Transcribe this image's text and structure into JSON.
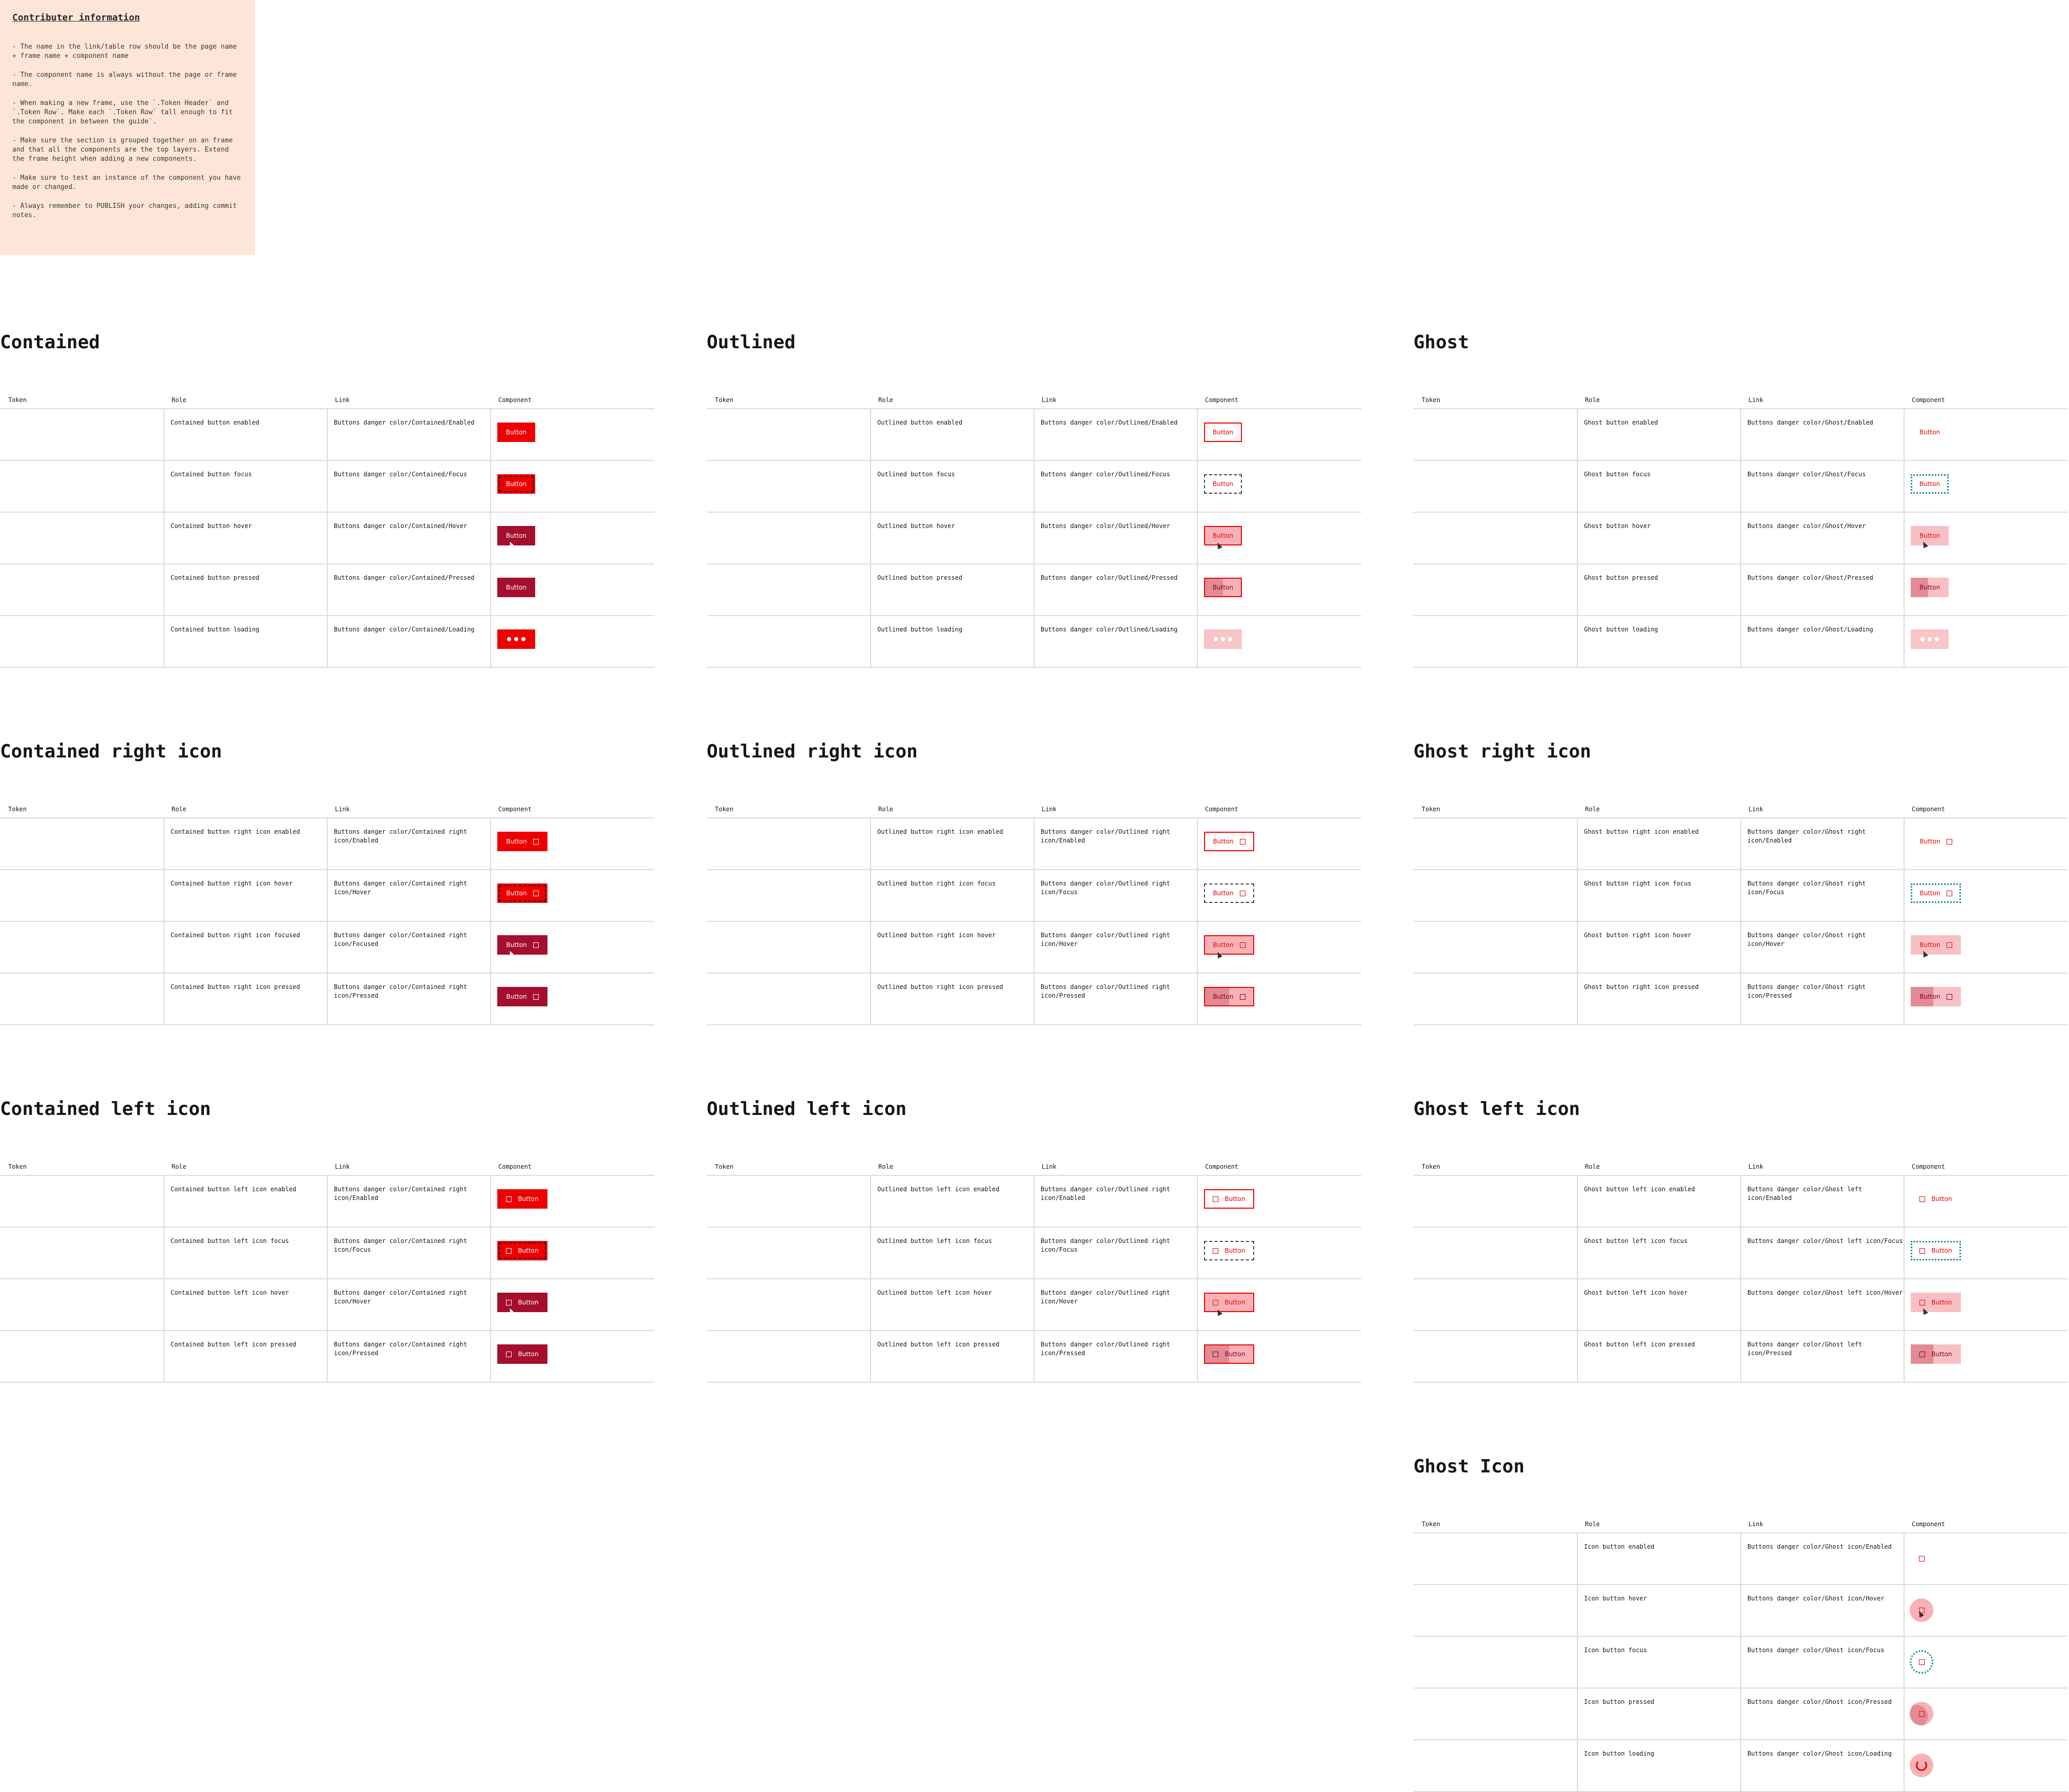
{
  "info": {
    "title": "Contributer information",
    "paragraphs": [
      "- The name in the link/table row should be the page name + frame name + component name",
      "- The component name is always without the page or frame name.",
      "- When making a new frame, use the `.Token Header` and `.Token Row`. Make each `.Token Row` tall enough to fit the component in between the guide`.",
      "- Make sure the section is grouped together on an frame and that all the components are the top layers. Extend the frame height when adding a new components.",
      "- Make sure to test an instance of the component you have made or changed.",
      "- Always remember to PUBLISH your changes, adding commit notes."
    ]
  },
  "headers": [
    "Token",
    "Role",
    "Link",
    "Component"
  ],
  "button_label": "Button",
  "colors": {
    "danger": "#ee0000",
    "danger_hover": "#a50e2d",
    "focus_ring": "#1d8a98",
    "ghost_hover": "#f8b2b7",
    "info_bg": "#fde6d7"
  },
  "sections": [
    {
      "title": "Contained",
      "kind": "contained",
      "icon": "none",
      "rows": [
        {
          "role": "Contained button enabled",
          "link": "Buttons danger color/Contained/Enabled",
          "state": "enabled"
        },
        {
          "role": "Contained button focus",
          "link": "Buttons danger color/Contained/Focus",
          "state": "focus"
        },
        {
          "role": "Contained button hover",
          "link": "Buttons danger color/Contained/Hover",
          "state": "hover"
        },
        {
          "role": "Contained button pressed",
          "link": "Buttons danger color/Contained/Pressed",
          "state": "pressed"
        },
        {
          "role": "Contained button loading",
          "link": "Buttons danger color/Contained/Loading",
          "state": "loading"
        }
      ]
    },
    {
      "title": "Outlined",
      "kind": "outlined",
      "icon": "none",
      "rows": [
        {
          "role": "Outlined button enabled",
          "link": "Buttons danger color/Outlined/Enabled",
          "state": "enabled"
        },
        {
          "role": "Outlined button focus",
          "link": "Buttons danger color/Outlined/Focus",
          "state": "focus"
        },
        {
          "role": "Outlined button hover",
          "link": "Buttons danger color/Outlined/Hover",
          "state": "hover"
        },
        {
          "role": "Outlined button pressed",
          "link": "Buttons danger color/Outlined/Pressed",
          "state": "pressed"
        },
        {
          "role": "Outlined button loading",
          "link": "Buttons danger color/Outlined/Loading",
          "state": "loading"
        }
      ]
    },
    {
      "title": "Ghost",
      "kind": "ghost",
      "icon": "none",
      "rows": [
        {
          "role": "Ghost button enabled",
          "link": "Buttons danger color/Ghost/Enabled",
          "state": "enabled"
        },
        {
          "role": "Ghost button focus",
          "link": "Buttons danger color/Ghost/Focus",
          "state": "focus"
        },
        {
          "role": "Ghost button hover",
          "link": "Buttons danger color/Ghost/Hover",
          "state": "hover"
        },
        {
          "role": "Ghost button pressed",
          "link": "Buttons danger color/Ghost/Pressed",
          "state": "pressed"
        },
        {
          "role": "Ghost button loading",
          "link": "Buttons danger color/Ghost/Loading",
          "state": "loading"
        }
      ]
    },
    {
      "title": "Contained right icon",
      "kind": "contained",
      "icon": "right",
      "rows": [
        {
          "role": "Contained button right icon enabled",
          "link": "Buttons danger color/Contained right icon/Enabled",
          "state": "enabled"
        },
        {
          "role": "Contained button right icon hover",
          "link": "Buttons danger color/Contained right icon/Hover",
          "state": "focus"
        },
        {
          "role": "Contained button right icon focused",
          "link": "Buttons danger color/Contained right icon/Focused",
          "state": "hover"
        },
        {
          "role": "Contained button right icon pressed",
          "link": "Buttons danger color/Contained right icon/Pressed",
          "state": "pressed"
        }
      ]
    },
    {
      "title": "Outlined right icon",
      "kind": "outlined",
      "icon": "right",
      "rows": [
        {
          "role": "Outlined button right icon enabled",
          "link": "Buttons danger color/Outlined right icon/Enabled",
          "state": "enabled"
        },
        {
          "role": "Outlined button right icon focus",
          "link": "Buttons danger color/Outlined right icon/Focus",
          "state": "focus"
        },
        {
          "role": "Outlined button right icon hover",
          "link": "Buttons danger color/Outlined right icon/Hover",
          "state": "hover"
        },
        {
          "role": "Outlined button right icon pressed",
          "link": "Buttons danger color/Outlined right icon/Pressed",
          "state": "pressed"
        }
      ]
    },
    {
      "title": "Ghost right icon",
      "kind": "ghost",
      "icon": "right",
      "rows": [
        {
          "role": "Ghost button right icon enabled",
          "link": "Buttons danger color/Ghost right icon/Enabled",
          "state": "enabled"
        },
        {
          "role": "Ghost button right icon focus",
          "link": "Buttons danger color/Ghost right icon/Focus",
          "state": "focus"
        },
        {
          "role": "Ghost button right icon hover",
          "link": "Buttons danger color/Ghost right icon/Hover",
          "state": "hover"
        },
        {
          "role": "Ghost button right icon pressed",
          "link": "Buttons danger color/Ghost right icon/Pressed",
          "state": "pressed"
        }
      ]
    },
    {
      "title": "Contained left icon",
      "kind": "contained",
      "icon": "left",
      "rows": [
        {
          "role": "Contained button left icon enabled",
          "link": "Buttons danger color/Contained right icon/Enabled",
          "state": "enabled"
        },
        {
          "role": "Contained button left icon focus",
          "link": "Buttons danger color/Contained right icon/Focus",
          "state": "focus"
        },
        {
          "role": "Contained button left icon hover",
          "link": "Buttons danger color/Contained right icon/Hover",
          "state": "hover"
        },
        {
          "role": "Contained button left icon pressed",
          "link": "Buttons danger color/Contained right icon/Pressed",
          "state": "pressed"
        }
      ]
    },
    {
      "title": "Outlined left icon",
      "kind": "outlined",
      "icon": "left",
      "rows": [
        {
          "role": "Outlined button left icon enabled",
          "link": "Buttons danger color/Outlined right icon/Enabled",
          "state": "enabled"
        },
        {
          "role": "Outlined button left icon focus",
          "link": "Buttons danger color/Outlined right icon/Focus",
          "state": "focus"
        },
        {
          "role": "Outlined button left icon hover",
          "link": "Buttons danger color/Outlined right icon/Hover",
          "state": "hover"
        },
        {
          "role": "Outlined button left icon pressed",
          "link": "Buttons danger color/Outlined right icon/Pressed",
          "state": "pressed"
        }
      ]
    },
    {
      "title": "Ghost left icon",
      "kind": "ghost",
      "icon": "left",
      "rows": [
        {
          "role": "Ghost button left icon enabled",
          "link": "Buttons danger color/Ghost left icon/Enabled",
          "state": "enabled"
        },
        {
          "role": "Ghost button left icon focus",
          "link": "Buttons danger color/Ghost left icon/Focus",
          "state": "focus"
        },
        {
          "role": "Ghost button left icon hover",
          "link": "Buttons danger color/Ghost left icon/Hover",
          "state": "hover"
        },
        {
          "role": "Ghost button left icon pressed",
          "link": "Buttons danger color/Ghost left icon/Pressed",
          "state": "pressed"
        }
      ]
    },
    {
      "title": "Ghost Icon",
      "kind": "icon",
      "icon": "only",
      "rows": [
        {
          "role": "Icon button enabled",
          "link": "Buttons danger color/Ghost icon/Enabled",
          "state": "enabled"
        },
        {
          "role": "Icon button hover",
          "link": "Buttons danger color/Ghost icon/Hover",
          "state": "hover"
        },
        {
          "role": "Icon button focus",
          "link": "Buttons danger color/Ghost icon/Focus",
          "state": "focus"
        },
        {
          "role": "Icon button pressed",
          "link": "Buttons danger color/Ghost icon/Pressed",
          "state": "pressed"
        },
        {
          "role": "Icon button loading",
          "link": "Buttons danger color/Ghost icon/Loading",
          "state": "loading"
        }
      ]
    }
  ]
}
